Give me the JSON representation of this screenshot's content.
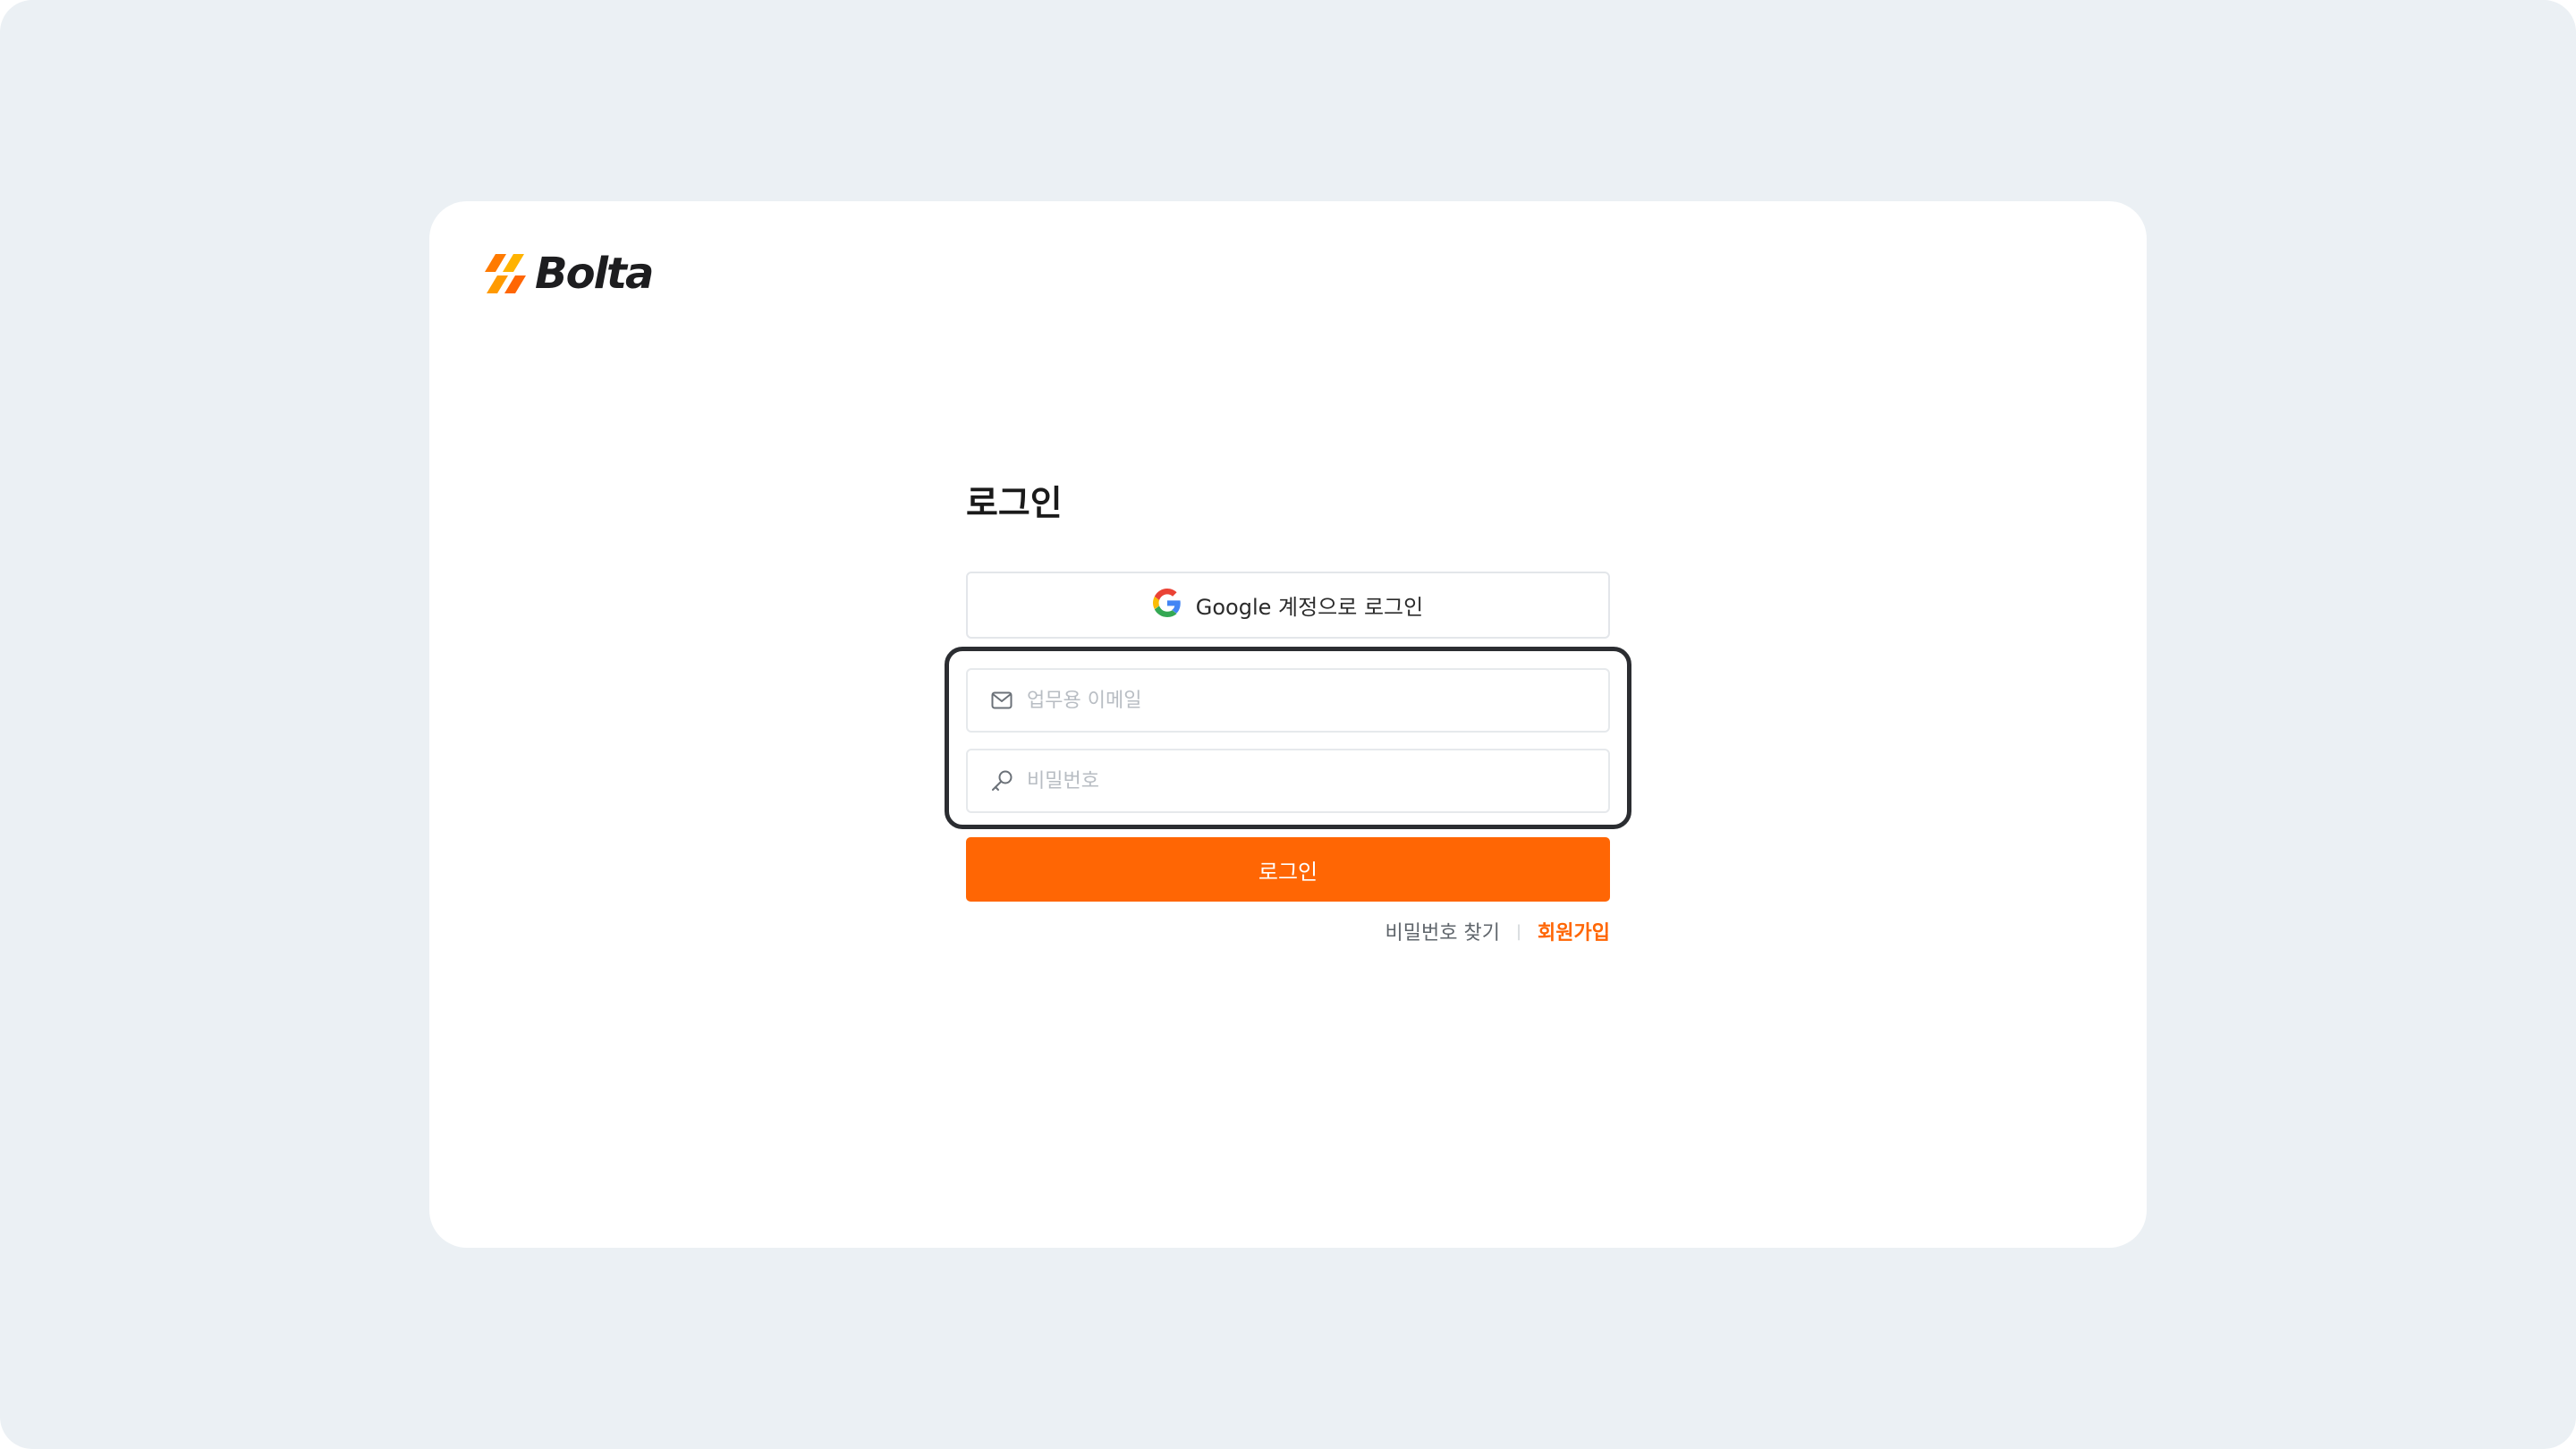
{
  "brand": {
    "name": "Bolta",
    "accent_color": "#ff6604",
    "logo_icon": "bolt-logo-icon"
  },
  "login": {
    "title": "로그인",
    "google_button_label": "Google 계정으로 로그인",
    "google_icon": "google-icon",
    "email": {
      "placeholder": "업무용 이메일",
      "value": "",
      "icon": "mail-icon"
    },
    "password": {
      "placeholder": "비밀번호",
      "value": "",
      "icon": "key-icon"
    },
    "submit_label": "로그인",
    "find_password_label": "비밀번호 찾기",
    "divider": "|",
    "signup_label": "회원가입"
  }
}
